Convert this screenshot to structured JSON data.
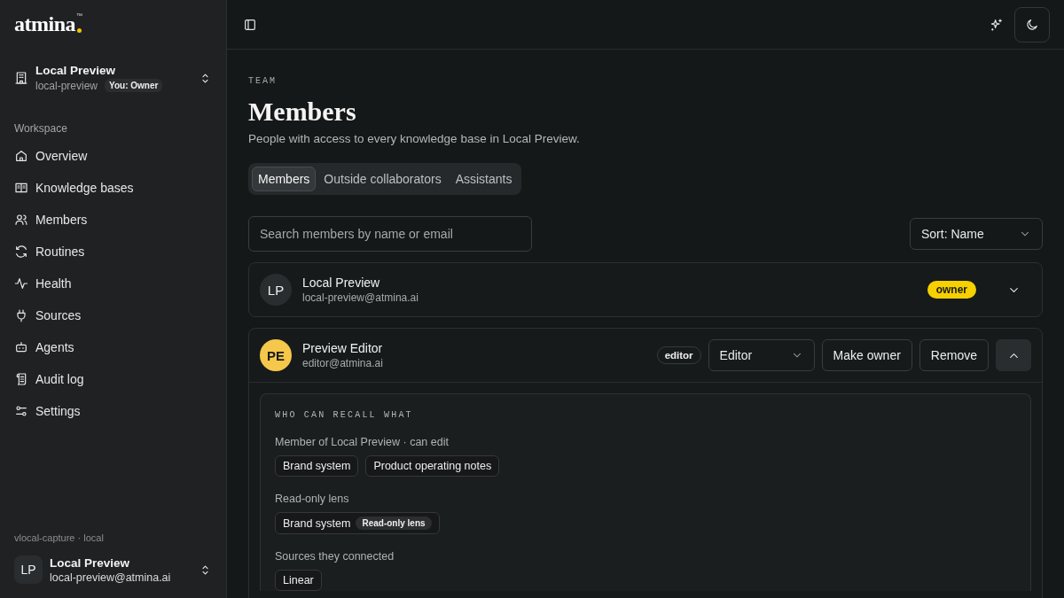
{
  "logo": {
    "name": "atmina",
    "mark": "™"
  },
  "workspace": {
    "name": "Local Preview",
    "slug": "local-preview",
    "role": "You: Owner"
  },
  "sidebar": {
    "section": "Workspace",
    "items": [
      {
        "label": "Overview"
      },
      {
        "label": "Knowledge bases"
      },
      {
        "label": "Members"
      },
      {
        "label": "Routines"
      },
      {
        "label": "Health"
      },
      {
        "label": "Sources"
      },
      {
        "label": "Agents"
      },
      {
        "label": "Audit log"
      },
      {
        "label": "Settings"
      }
    ],
    "footer_note": "vlocal-capture · local",
    "user": {
      "initials": "LP",
      "name": "Local Preview",
      "email": "local-preview@atmina.ai"
    }
  },
  "page": {
    "eyebrow": "TEAM",
    "title": "Members",
    "description": "People with access to every knowledge base in Local Preview."
  },
  "tabs": [
    {
      "label": "Members",
      "selected": true
    },
    {
      "label": "Outside collaborators",
      "selected": false
    },
    {
      "label": "Assistants",
      "selected": false
    }
  ],
  "search": {
    "placeholder": "Search members by name or email"
  },
  "sort": {
    "value": "Sort: Name"
  },
  "members": [
    {
      "initials": "LP",
      "color": "#2a2d30",
      "name": "Local Preview",
      "email": "local-preview@atmina.ai",
      "role": {
        "label": "owner",
        "kind": "filled"
      },
      "expanded": false
    },
    {
      "initials": "PE",
      "color": "#f5c84b",
      "name": "Preview Editor",
      "email": "editor@atmina.ai",
      "role": {
        "label": "editor",
        "kind": "outline"
      },
      "role_select": "Editor",
      "actions": [
        "Make owner",
        "Remove"
      ],
      "expanded": true,
      "access": {
        "title": "WHO CAN RECALL WHAT",
        "groups": [
          {
            "label": "Member of Local Preview · can edit",
            "chips": [
              {
                "label": "Brand system"
              },
              {
                "label": "Product operating notes"
              }
            ]
          },
          {
            "label": "Read-only lens",
            "chips": [
              {
                "label": "Brand system",
                "tag": "Read-only lens"
              }
            ]
          },
          {
            "label": "Sources they connected",
            "chips": [
              {
                "label": "Linear"
              }
            ]
          }
        ]
      }
    }
  ]
}
